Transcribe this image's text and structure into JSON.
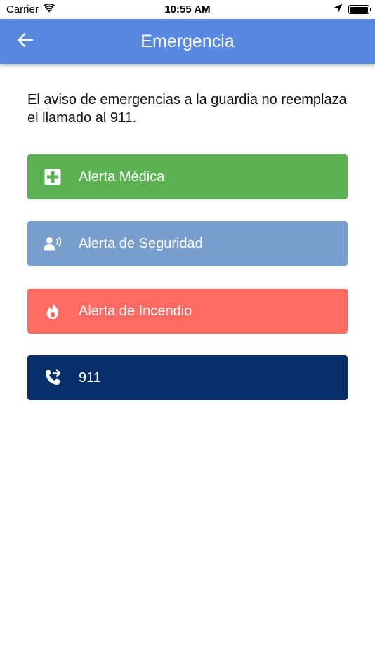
{
  "status_bar": {
    "carrier": "Carrier",
    "time": "10:55 AM"
  },
  "header": {
    "title": "Emergencia"
  },
  "notice": {
    "text": "El aviso de emergencias a la guardia no reemplaza el llamado al 911."
  },
  "buttons": [
    {
      "label": "Alerta Médica",
      "icon": "medical-cross-icon",
      "color": "#5cb252"
    },
    {
      "label": "Alerta de Seguridad",
      "icon": "person-alarm-icon",
      "color": "#789ecd"
    },
    {
      "label": "Alerta de Incendio",
      "icon": "fire-icon",
      "color": "#ff6a63"
    },
    {
      "label": "911",
      "icon": "phone-forward-icon",
      "color": "#07306a"
    }
  ],
  "colors": {
    "header": "#5689df",
    "background": "#ffffff"
  }
}
